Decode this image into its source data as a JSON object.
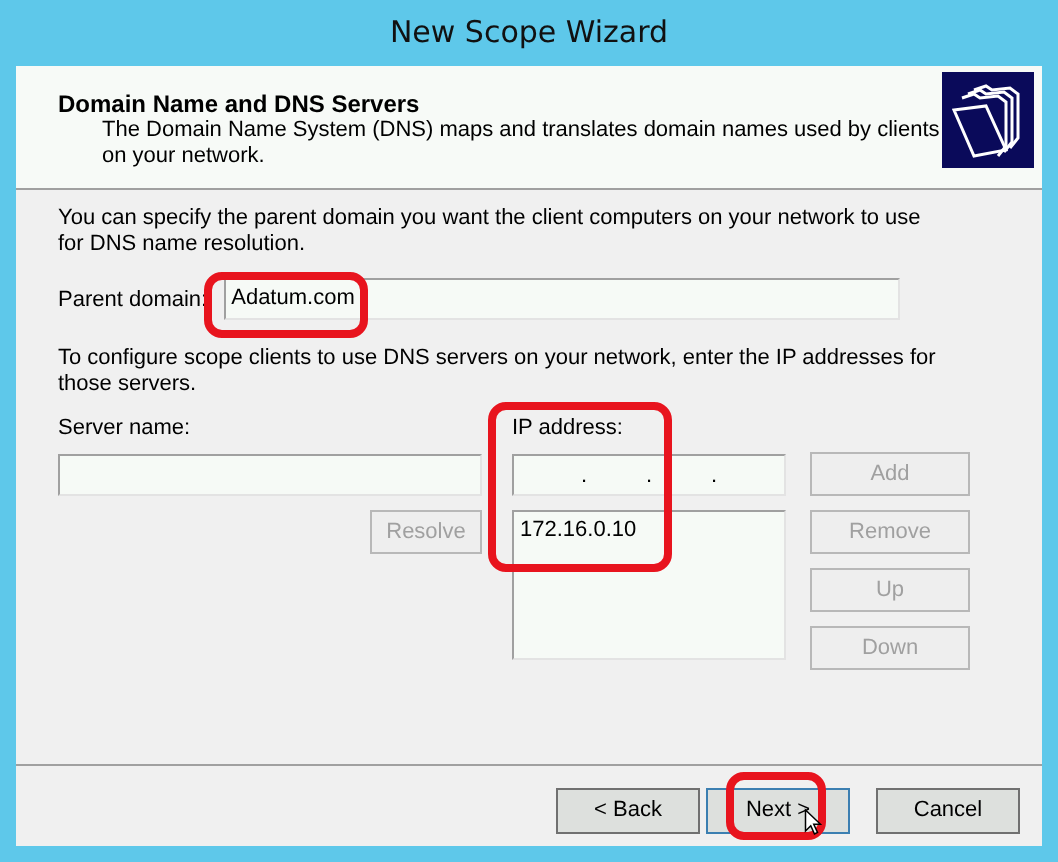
{
  "window": {
    "title": "New Scope Wizard"
  },
  "header": {
    "title": "Domain Name and DNS Servers",
    "description": "The Domain Name System (DNS) maps and translates domain names used by clients on your network."
  },
  "intro": "You can specify the parent domain you want the client computers on your network to use for DNS name resolution.",
  "parent_domain": {
    "label": "Parent domain:",
    "value": "Adatum.com"
  },
  "dns_intro": "To configure scope clients to use DNS servers on your network, enter the IP addresses for those servers.",
  "server_name": {
    "label": "Server name:"
  },
  "resolve_button": {
    "label": "Resolve",
    "disabled": true
  },
  "ip_address": {
    "label": "IP address:",
    "separator": "."
  },
  "ip_list": [
    "172.16.0.10"
  ],
  "side_buttons": [
    {
      "label": "Add",
      "disabled": true
    },
    {
      "label": "Remove",
      "disabled": true
    },
    {
      "label": "Up",
      "disabled": true
    },
    {
      "label": "Down",
      "disabled": true
    }
  ],
  "footer_buttons": [
    {
      "label": "< Back",
      "disabled": false,
      "focused": false
    },
    {
      "label": "Next >",
      "disabled": false,
      "focused": true
    },
    {
      "label": "Cancel",
      "disabled": false,
      "focused": false
    }
  ]
}
